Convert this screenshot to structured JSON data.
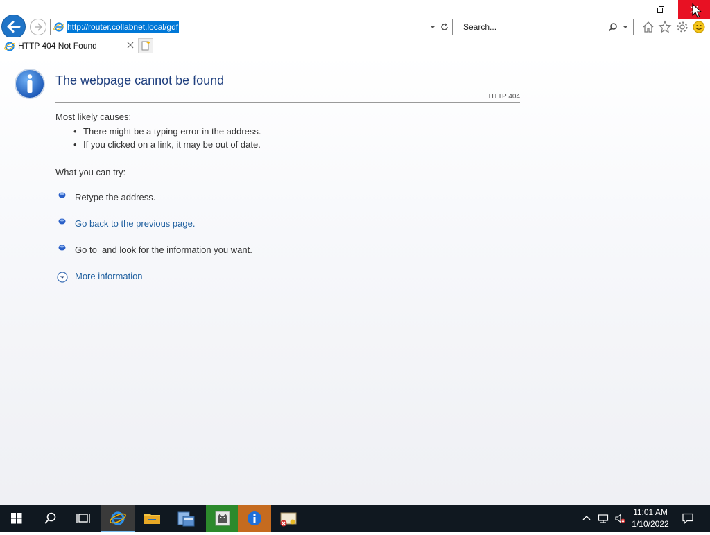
{
  "browser": {
    "address_url": "http://router.collabnet.local/gdf",
    "search_placeholder": "Search...",
    "tab_title": "HTTP 404 Not Found"
  },
  "error_page": {
    "title": "The webpage cannot be found",
    "code": "HTTP 404",
    "causes_label": "Most likely causes:",
    "causes": [
      "There might be a typing error in the address.",
      "If you clicked on a link, it may be out of date."
    ],
    "try_label": "What you can try:",
    "try_items": [
      "Retype the address.",
      "Go back to the previous page.",
      "Go to  and look for the information you want."
    ],
    "more_info": "More information"
  },
  "taskbar": {
    "time": "11:01 AM",
    "date": "1/10/2022",
    "accent": "#76b9ed"
  },
  "colors": {
    "title_blue": "#1f3f7e",
    "link_blue": "#1f5f9f",
    "close_red": "#e81123",
    "ie_back_blue": "#1f74c7"
  }
}
